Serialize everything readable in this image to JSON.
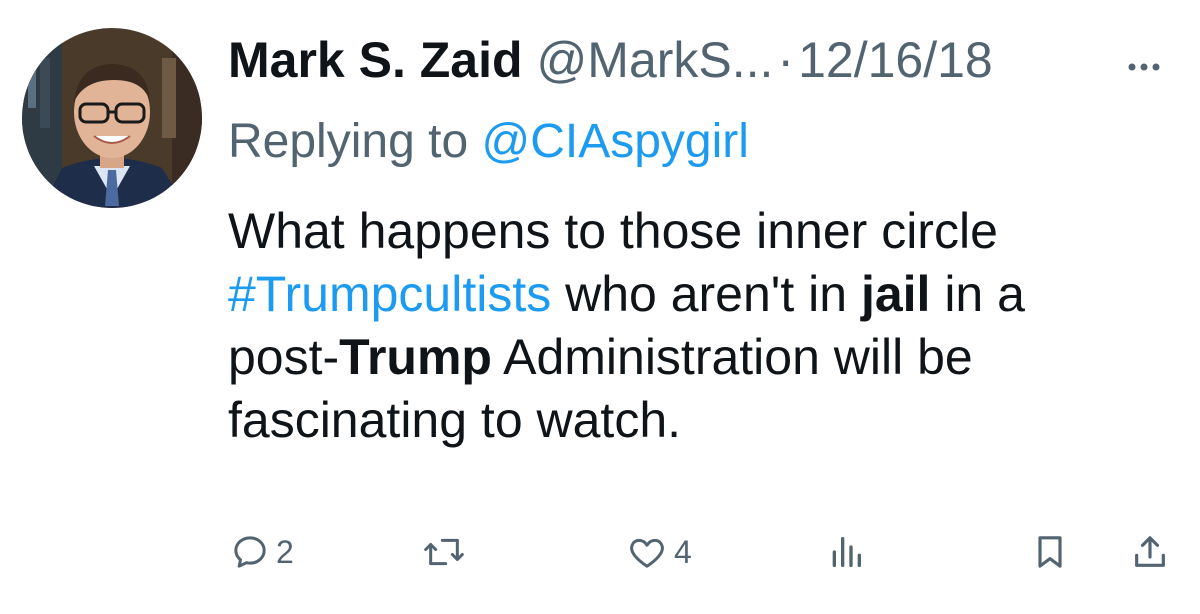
{
  "tweet": {
    "author": {
      "name": "Mark S. Zaid",
      "handle": "@MarkS...",
      "avatar": "profile-photo"
    },
    "separator": "·",
    "date": "12/16/18",
    "more_icon": "more-horizontal-icon",
    "reply": {
      "prefix": "Replying to ",
      "mention": "@CIAspygirl"
    },
    "text": {
      "l1": "What happens to those inner circle",
      "hashtag": "#Trumpcultists",
      "l2_a": " who aren't in ",
      "l2_bold": "jail",
      "l2_b": " in a",
      "l3_a": "post-",
      "l3_bold": "Trump",
      "l3_b": " Administration will be",
      "l4": "fascinating to watch."
    },
    "actions": {
      "reply": {
        "icon": "reply-icon",
        "count": "2"
      },
      "retweet": {
        "icon": "retweet-icon",
        "count": ""
      },
      "like": {
        "icon": "heart-icon",
        "count": "4"
      },
      "views": {
        "icon": "analytics-icon",
        "count": ""
      },
      "bookmark": {
        "icon": "bookmark-icon"
      },
      "share": {
        "icon": "share-icon"
      }
    },
    "colors": {
      "text": "#0f1419",
      "secondary": "#536471",
      "link": "#1d9bf0"
    }
  }
}
